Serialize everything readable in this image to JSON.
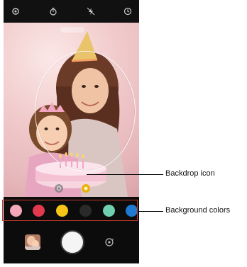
{
  "callouts": {
    "backdrop_icon": "Backdrop icon",
    "background_colors": "Background colors"
  },
  "swatches": [
    "#f4a7b9",
    "#e2394d",
    "#f5c518",
    "#2a2a2a",
    "#6ed0b0",
    "#1f7ad1"
  ],
  "frame_color": "#c0392b",
  "icons": {
    "settings": "settings-icon",
    "timer_off": "timer-off-icon",
    "flash_off": "flash-off-icon",
    "timer": "timer-icon",
    "mode_left": "mode-toggle-icon",
    "backdrop": "backdrop-icon",
    "gallery": "gallery-thumbnail",
    "shutter": "shutter-button",
    "switch": "switch-camera-icon"
  }
}
